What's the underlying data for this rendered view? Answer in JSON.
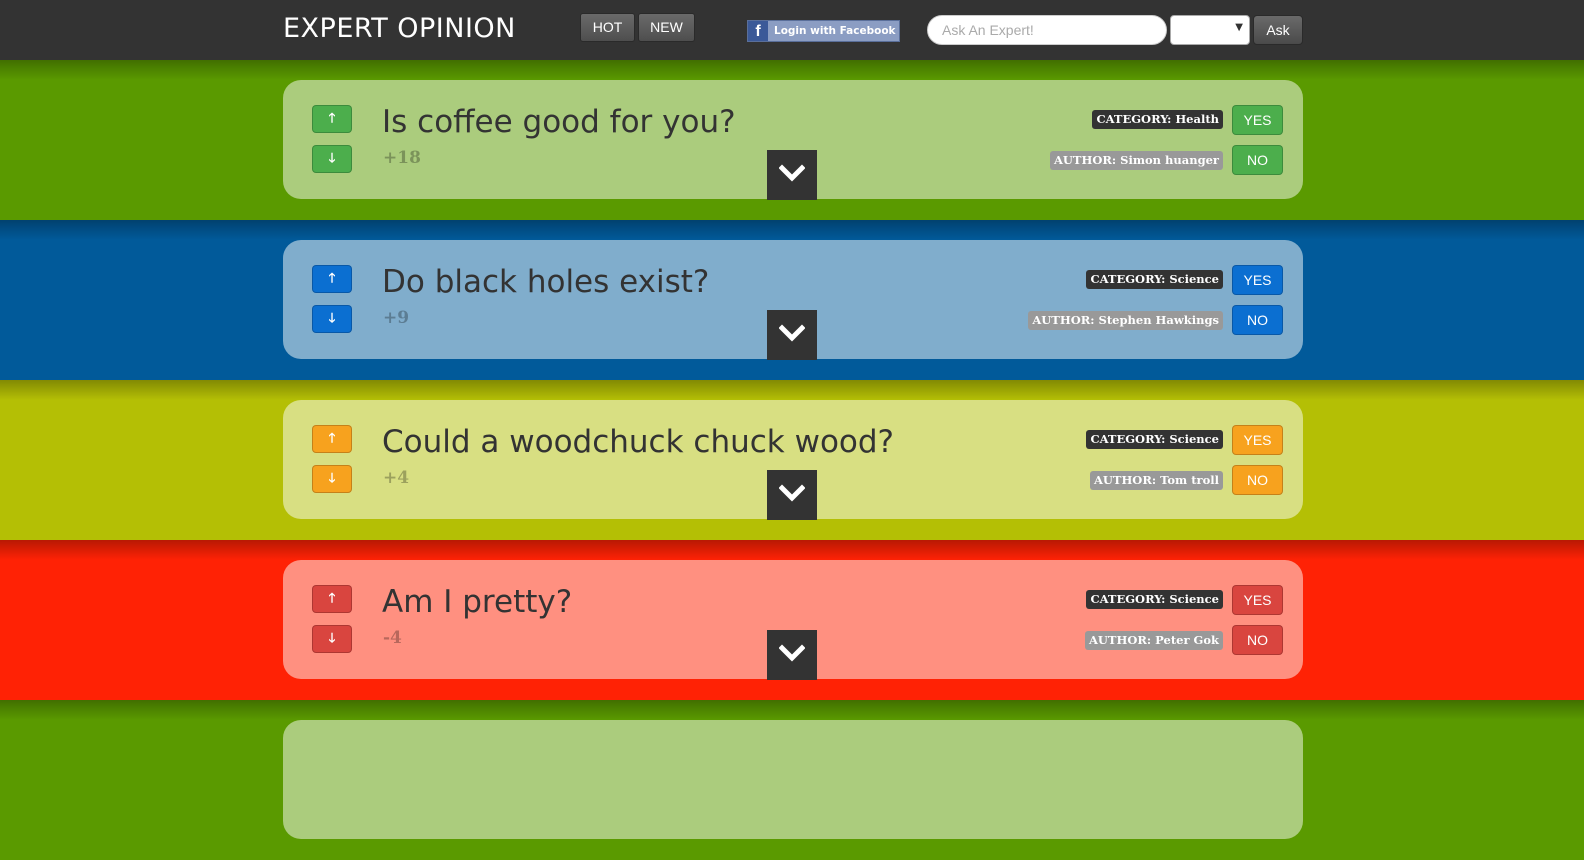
{
  "header": {
    "logo": "EXPERT OPINION",
    "hot_label": "HOT",
    "new_label": "NEW",
    "facebook_label": "Login with Facebook",
    "search_placeholder": "Ask An Expert!",
    "ask_label": "Ask",
    "select_value": ""
  },
  "questions": [
    {
      "title": "Is coffee good for you?",
      "score": "+18",
      "category": "CATEGORY: Health",
      "author": "AUTHOR: Simon huanger",
      "yes_label": "YES",
      "no_label": "NO",
      "theme": {
        "band": "#5a9a00",
        "card": "#abcc7d",
        "button": "#4cae4c"
      }
    },
    {
      "title": "Do black holes exist?",
      "score": "+9",
      "category": "CATEGORY: Science",
      "author": "AUTHOR: Stephen Hawkings",
      "yes_label": "YES",
      "no_label": "NO",
      "theme": {
        "band": "#015a9a",
        "card": "#80adcc",
        "button": "#0b6fd1"
      }
    },
    {
      "title": "Could a woodchuck chuck wood?",
      "score": "+4",
      "category": "CATEGORY: Science",
      "author": "AUTHOR: Tom troll",
      "yes_label": "YES",
      "no_label": "NO",
      "theme": {
        "band": "#b4bf05",
        "card": "#d8df82",
        "button": "#f7a21e"
      }
    },
    {
      "title": "Am I pretty?",
      "score": "-4",
      "category": "CATEGORY: Science",
      "author": "AUTHOR: Peter Gok",
      "yes_label": "YES",
      "no_label": "NO",
      "theme": {
        "band": "#ff2205",
        "card": "#ff9080",
        "button": "#d9453f"
      }
    },
    {
      "title": "",
      "score": "",
      "category": "",
      "author": "",
      "yes_label": "",
      "no_label": "",
      "theme": {
        "band": "#5a9a00",
        "card": "#abcc7d",
        "button": "#4cae4c"
      }
    }
  ]
}
